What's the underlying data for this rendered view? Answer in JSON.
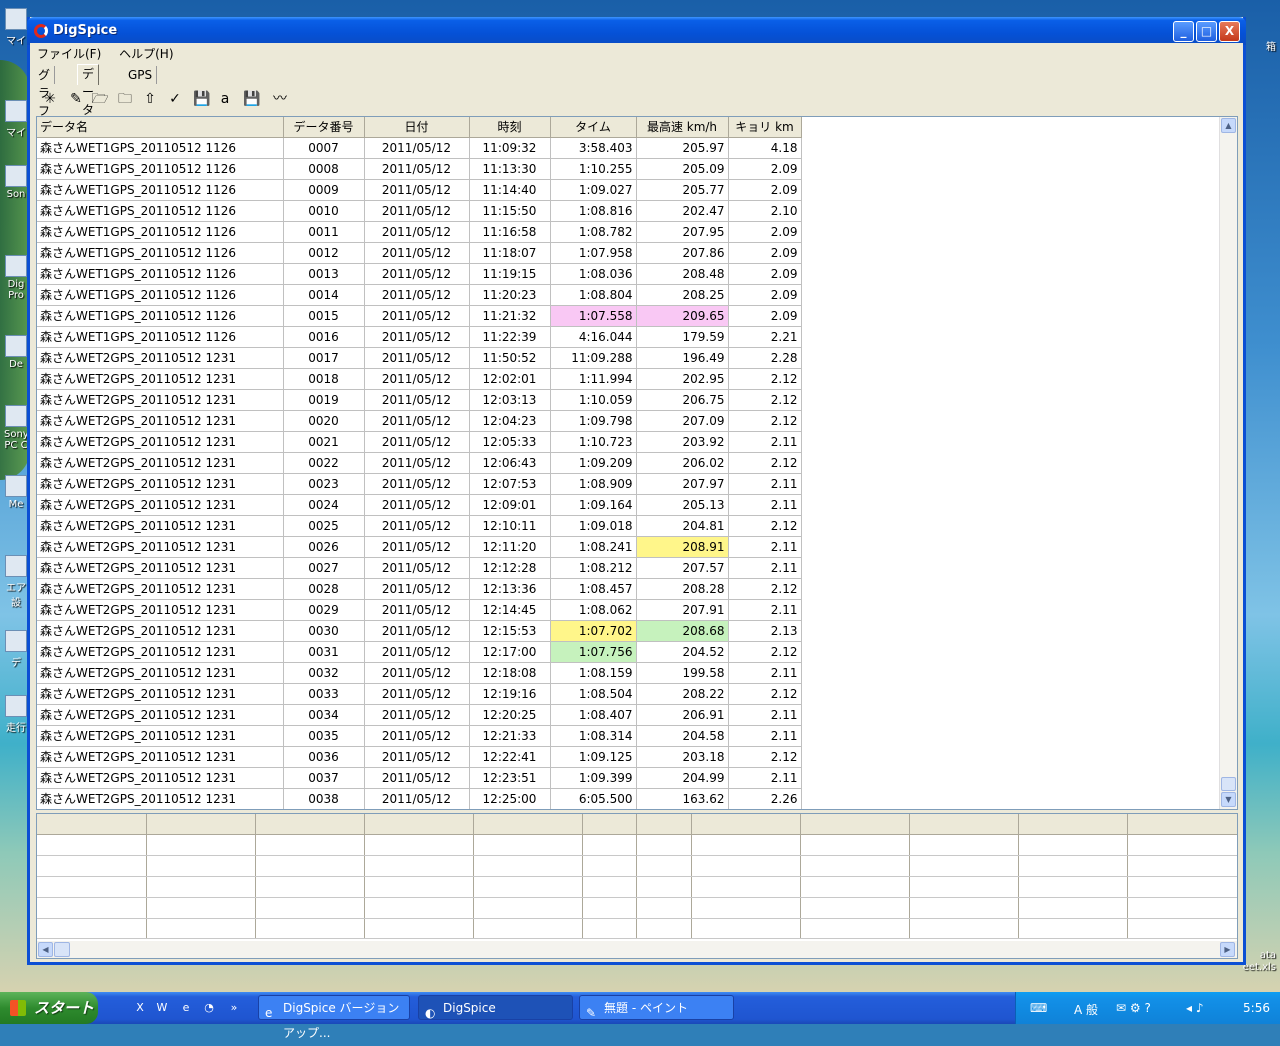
{
  "desktop": {
    "icons": [
      {
        "label": "マイ"
      },
      {
        "label": "マイ"
      },
      {
        "label": "Son"
      },
      {
        "label": "Dig Pro"
      },
      {
        "label": "De"
      },
      {
        "label": "Sony PC C"
      },
      {
        "label": "Me"
      },
      {
        "label": "エア 設"
      },
      {
        "label": "デ"
      },
      {
        "label": "走行"
      }
    ],
    "right_labels": [
      "箱",
      "ata",
      "eet.xls"
    ]
  },
  "window": {
    "title": "DigSpice",
    "controls": {
      "minimize": "_",
      "maximize": "□",
      "close": "X"
    },
    "menu": [
      "ファイル(F)",
      "ヘルプ(H)"
    ],
    "tabs": [
      {
        "label": "グラフ",
        "active": false
      },
      {
        "label": "データ",
        "active": true
      },
      {
        "label": "GPS",
        "active": false
      }
    ],
    "toolbar": [
      {
        "icon": "sparkle-icon",
        "glyph": "✳"
      },
      {
        "icon": "edit-icon",
        "glyph": "✎"
      },
      {
        "icon": "folder-open-icon",
        "glyph": "🗁"
      },
      {
        "icon": "folder-icon",
        "glyph": "🗀"
      },
      {
        "icon": "upload-arrow-icon",
        "glyph": "⇧"
      },
      {
        "icon": "check-graph-icon",
        "glyph": "✓"
      },
      {
        "icon": "save-icon",
        "glyph": "💾"
      },
      {
        "icon": "a-arrow-icon",
        "glyph": "a"
      },
      {
        "icon": "save-black-icon",
        "glyph": "💾"
      },
      {
        "icon": "waveform-icon",
        "glyph": "〰"
      }
    ]
  },
  "table": {
    "columns": [
      "データ名",
      "データ番号",
      "日付",
      "時刻",
      "タイム",
      "最高速 km/h",
      "キョリ km"
    ],
    "rows": [
      {
        "name": "森さんWET1GPS_20110512 1126",
        "no": "0007",
        "date": "2011/05/12",
        "time": "11:09:32",
        "lap": "3:58.403",
        "speed": "205.97",
        "dist": "4.18",
        "lapHL": "",
        "speedHL": ""
      },
      {
        "name": "森さんWET1GPS_20110512 1126",
        "no": "0008",
        "date": "2011/05/12",
        "time": "11:13:30",
        "lap": "1:10.255",
        "speed": "205.09",
        "dist": "2.09",
        "lapHL": "",
        "speedHL": ""
      },
      {
        "name": "森さんWET1GPS_20110512 1126",
        "no": "0009",
        "date": "2011/05/12",
        "time": "11:14:40",
        "lap": "1:09.027",
        "speed": "205.77",
        "dist": "2.09",
        "lapHL": "",
        "speedHL": ""
      },
      {
        "name": "森さんWET1GPS_20110512 1126",
        "no": "0010",
        "date": "2011/05/12",
        "time": "11:15:50",
        "lap": "1:08.816",
        "speed": "202.47",
        "dist": "2.10",
        "lapHL": "",
        "speedHL": ""
      },
      {
        "name": "森さんWET1GPS_20110512 1126",
        "no": "0011",
        "date": "2011/05/12",
        "time": "11:16:58",
        "lap": "1:08.782",
        "speed": "207.95",
        "dist": "2.09",
        "lapHL": "",
        "speedHL": ""
      },
      {
        "name": "森さんWET1GPS_20110512 1126",
        "no": "0012",
        "date": "2011/05/12",
        "time": "11:18:07",
        "lap": "1:07.958",
        "speed": "207.86",
        "dist": "2.09",
        "lapHL": "",
        "speedHL": ""
      },
      {
        "name": "森さんWET1GPS_20110512 1126",
        "no": "0013",
        "date": "2011/05/12",
        "time": "11:19:15",
        "lap": "1:08.036",
        "speed": "208.48",
        "dist": "2.09",
        "lapHL": "",
        "speedHL": ""
      },
      {
        "name": "森さんWET1GPS_20110512 1126",
        "no": "0014",
        "date": "2011/05/12",
        "time": "11:20:23",
        "lap": "1:08.804",
        "speed": "208.25",
        "dist": "2.09",
        "lapHL": "",
        "speedHL": ""
      },
      {
        "name": "森さんWET1GPS_20110512 1126",
        "no": "0015",
        "date": "2011/05/12",
        "time": "11:21:32",
        "lap": "1:07.558",
        "speed": "209.65",
        "dist": "2.09",
        "lapHL": "#f9c8f4",
        "speedHL": "#f9c8f4"
      },
      {
        "name": "森さんWET1GPS_20110512 1126",
        "no": "0016",
        "date": "2011/05/12",
        "time": "11:22:39",
        "lap": "4:16.044",
        "speed": "179.59",
        "dist": "2.21",
        "lapHL": "",
        "speedHL": ""
      },
      {
        "name": "森さんWET2GPS_20110512 1231",
        "no": "0017",
        "date": "2011/05/12",
        "time": "11:50:52",
        "lap": "11:09.288",
        "speed": "196.49",
        "dist": "2.28",
        "lapHL": "",
        "speedHL": ""
      },
      {
        "name": "森さんWET2GPS_20110512 1231",
        "no": "0018",
        "date": "2011/05/12",
        "time": "12:02:01",
        "lap": "1:11.994",
        "speed": "202.95",
        "dist": "2.12",
        "lapHL": "",
        "speedHL": ""
      },
      {
        "name": "森さんWET2GPS_20110512 1231",
        "no": "0019",
        "date": "2011/05/12",
        "time": "12:03:13",
        "lap": "1:10.059",
        "speed": "206.75",
        "dist": "2.12",
        "lapHL": "",
        "speedHL": ""
      },
      {
        "name": "森さんWET2GPS_20110512 1231",
        "no": "0020",
        "date": "2011/05/12",
        "time": "12:04:23",
        "lap": "1:09.798",
        "speed": "207.09",
        "dist": "2.12",
        "lapHL": "",
        "speedHL": ""
      },
      {
        "name": "森さんWET2GPS_20110512 1231",
        "no": "0021",
        "date": "2011/05/12",
        "time": "12:05:33",
        "lap": "1:10.723",
        "speed": "203.92",
        "dist": "2.11",
        "lapHL": "",
        "speedHL": ""
      },
      {
        "name": "森さんWET2GPS_20110512 1231",
        "no": "0022",
        "date": "2011/05/12",
        "time": "12:06:43",
        "lap": "1:09.209",
        "speed": "206.02",
        "dist": "2.12",
        "lapHL": "",
        "speedHL": ""
      },
      {
        "name": "森さんWET2GPS_20110512 1231",
        "no": "0023",
        "date": "2011/05/12",
        "time": "12:07:53",
        "lap": "1:08.909",
        "speed": "207.97",
        "dist": "2.11",
        "lapHL": "",
        "speedHL": ""
      },
      {
        "name": "森さんWET2GPS_20110512 1231",
        "no": "0024",
        "date": "2011/05/12",
        "time": "12:09:01",
        "lap": "1:09.164",
        "speed": "205.13",
        "dist": "2.11",
        "lapHL": "",
        "speedHL": ""
      },
      {
        "name": "森さんWET2GPS_20110512 1231",
        "no": "0025",
        "date": "2011/05/12",
        "time": "12:10:11",
        "lap": "1:09.018",
        "speed": "204.81",
        "dist": "2.12",
        "lapHL": "",
        "speedHL": ""
      },
      {
        "name": "森さんWET2GPS_20110512 1231",
        "no": "0026",
        "date": "2011/05/12",
        "time": "12:11:20",
        "lap": "1:08.241",
        "speed": "208.91",
        "dist": "2.11",
        "lapHL": "",
        "speedHL": "#fff68a"
      },
      {
        "name": "森さんWET2GPS_20110512 1231",
        "no": "0027",
        "date": "2011/05/12",
        "time": "12:12:28",
        "lap": "1:08.212",
        "speed": "207.57",
        "dist": "2.11",
        "lapHL": "",
        "speedHL": ""
      },
      {
        "name": "森さんWET2GPS_20110512 1231",
        "no": "0028",
        "date": "2011/05/12",
        "time": "12:13:36",
        "lap": "1:08.457",
        "speed": "208.28",
        "dist": "2.12",
        "lapHL": "",
        "speedHL": ""
      },
      {
        "name": "森さんWET2GPS_20110512 1231",
        "no": "0029",
        "date": "2011/05/12",
        "time": "12:14:45",
        "lap": "1:08.062",
        "speed": "207.91",
        "dist": "2.11",
        "lapHL": "",
        "speedHL": ""
      },
      {
        "name": "森さんWET2GPS_20110512 1231",
        "no": "0030",
        "date": "2011/05/12",
        "time": "12:15:53",
        "lap": "1:07.702",
        "speed": "208.68",
        "dist": "2.13",
        "lapHL": "#fff68a",
        "speedHL": "#c6f2bd"
      },
      {
        "name": "森さんWET2GPS_20110512 1231",
        "no": "0031",
        "date": "2011/05/12",
        "time": "12:17:00",
        "lap": "1:07.756",
        "speed": "204.52",
        "dist": "2.12",
        "lapHL": "#c6f2bd",
        "speedHL": ""
      },
      {
        "name": "森さんWET2GPS_20110512 1231",
        "no": "0032",
        "date": "2011/05/12",
        "time": "12:18:08",
        "lap": "1:08.159",
        "speed": "199.58",
        "dist": "2.11",
        "lapHL": "",
        "speedHL": ""
      },
      {
        "name": "森さんWET2GPS_20110512 1231",
        "no": "0033",
        "date": "2011/05/12",
        "time": "12:19:16",
        "lap": "1:08.504",
        "speed": "208.22",
        "dist": "2.12",
        "lapHL": "",
        "speedHL": ""
      },
      {
        "name": "森さんWET2GPS_20110512 1231",
        "no": "0034",
        "date": "2011/05/12",
        "time": "12:20:25",
        "lap": "1:08.407",
        "speed": "206.91",
        "dist": "2.11",
        "lapHL": "",
        "speedHL": ""
      },
      {
        "name": "森さんWET2GPS_20110512 1231",
        "no": "0035",
        "date": "2011/05/12",
        "time": "12:21:33",
        "lap": "1:08.314",
        "speed": "204.58",
        "dist": "2.11",
        "lapHL": "",
        "speedHL": ""
      },
      {
        "name": "森さんWET2GPS_20110512 1231",
        "no": "0036",
        "date": "2011/05/12",
        "time": "12:22:41",
        "lap": "1:09.125",
        "speed": "203.18",
        "dist": "2.12",
        "lapHL": "",
        "speedHL": ""
      },
      {
        "name": "森さんWET2GPS_20110512 1231",
        "no": "0037",
        "date": "2011/05/12",
        "time": "12:23:51",
        "lap": "1:09.399",
        "speed": "204.99",
        "dist": "2.11",
        "lapHL": "",
        "speedHL": ""
      },
      {
        "name": "森さんWET2GPS_20110512 1231",
        "no": "0038",
        "date": "2011/05/12",
        "time": "12:25:00",
        "lap": "6:05.500",
        "speed": "163.62",
        "dist": "2.26",
        "lapHL": "",
        "speedHL": ""
      }
    ]
  },
  "taskbar": {
    "start_label": "スタート",
    "tasks": [
      {
        "label": "DigSpice バージョンアップ...",
        "active": false
      },
      {
        "label": "DigSpice",
        "active": true
      },
      {
        "label": "無題 - ペイント",
        "active": false
      }
    ],
    "tray": {
      "ime": "A 般",
      "clock": "5:56"
    }
  }
}
